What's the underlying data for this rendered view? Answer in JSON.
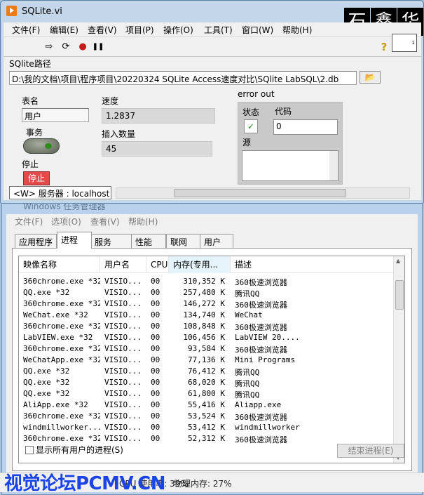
{
  "labview": {
    "window_title": "SQLite.vi",
    "logo_chars": [
      "石",
      "鑫",
      "华"
    ],
    "menu": [
      "文件(F)",
      "编辑(E)",
      "查看(V)",
      "项目(P)",
      "操作(O)",
      "工具(T)",
      "窗口(W)",
      "帮助(H)"
    ],
    "toolbar": {
      "run": "⇨",
      "run_cont": "⟳",
      "abort": "●",
      "pause": "❚❚",
      "help": "?"
    },
    "vi_icon_text": "1",
    "path_label": "SQlite路径",
    "path_value": "D:\\我的文档\\项目\\程序项目\\20220324 SQLite Access速度对比\\SQlite LabSQL\\2.db",
    "folder_icon": "📂",
    "table_label": "表名",
    "table_value": "用户",
    "speed_label": "速度",
    "speed_value": "1.2837",
    "transaction_label": "事务",
    "insert_label": "插入数量",
    "insert_value": "45",
    "stop_label": "停止",
    "stop_button": "停止",
    "error_out_label": "error out",
    "status_label": "状态",
    "status_value": "✓",
    "code_label": "代码",
    "code_value": "0",
    "source_label": "源",
    "server_value": "<W> 服务器 : localhost"
  },
  "taskmgr": {
    "window_title": "Windows 任务管理器",
    "menu": [
      "文件(F)",
      "选项(O)",
      "查看(V)",
      "帮助(H)"
    ],
    "tabs": [
      "应用程序",
      "进程",
      "服务",
      "性能",
      "联网",
      "用户"
    ],
    "active_tab": 1,
    "columns": [
      "映像名称",
      "用户名",
      "CPU",
      "内存(专用...",
      "描述"
    ],
    "rows": [
      [
        "360chrome.exe *32",
        "VISIO...",
        "00",
        "310,352 K",
        "360极速浏览器"
      ],
      [
        "QQ.exe *32",
        "VISIO...",
        "00",
        "257,480 K",
        "腾讯QQ"
      ],
      [
        "360chrome.exe *32",
        "VISIO...",
        "00",
        "146,272 K",
        "360极速浏览器"
      ],
      [
        "WeChat.exe *32",
        "VISIO...",
        "00",
        "134,740 K",
        "WeChat"
      ],
      [
        "360chrome.exe *32",
        "VISIO...",
        "00",
        "108,848 K",
        "360极速浏览器"
      ],
      [
        "LabVIEW.exe *32",
        "VISIO...",
        "00",
        "106,456 K",
        "LabVIEW 20...."
      ],
      [
        "360chrome.exe *32",
        "VISIO...",
        "00",
        "93,584 K",
        "360极速浏览器"
      ],
      [
        "WeChatApp.exe *32",
        "VISIO...",
        "00",
        "77,136 K",
        "Mini Programs"
      ],
      [
        "QQ.exe *32",
        "VISIO...",
        "00",
        "76,412 K",
        "腾讯QQ"
      ],
      [
        "QQ.exe *32",
        "VISIO...",
        "00",
        "68,020 K",
        "腾讯QQ"
      ],
      [
        "QQ.exe *32",
        "VISIO...",
        "00",
        "61,800 K",
        "腾讯QQ"
      ],
      [
        "AliApp.exe *32",
        "VISIO...",
        "00",
        "55,416 K",
        "Aliapp.exe"
      ],
      [
        "360chrome.exe *32",
        "VISIO...",
        "00",
        "53,524 K",
        "360极速浏览器"
      ],
      [
        "windmillworker...",
        "VISIO...",
        "00",
        "53,412 K",
        "windmillworker"
      ],
      [
        "360chrome.exe *32",
        "VISIO...",
        "00",
        "52,312 K",
        "360极速浏览器"
      ]
    ],
    "show_all_label": "显示所有用户的进程(S)",
    "end_button": "结束进程(E)",
    "status_cpu": "CPU 使用率: 39%",
    "status_mem": "物理内存: 27%"
  },
  "watermark": "视觉论坛PCMV.CN"
}
